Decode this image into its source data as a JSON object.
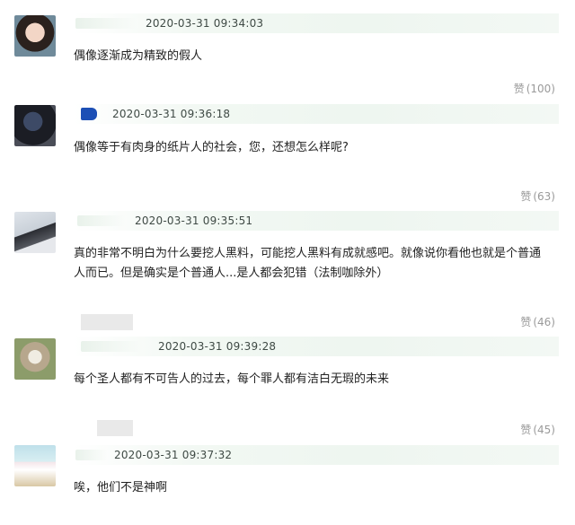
{
  "comments": [
    {
      "timestamp": "2020-03-31 09:34:03",
      "text": "偶像逐渐成为精致的假人",
      "likes_label": "赞",
      "likes_count": "(100)"
    },
    {
      "timestamp": "2020-03-31 09:36:18",
      "text": "偶像等于有肉身的纸片人的社会，您，还想怎么样呢?",
      "likes_label": "赞",
      "likes_count": "(63)"
    },
    {
      "timestamp": "2020-03-31 09:35:51",
      "text_line1": "真的非常不明白为什么要挖人黑料，可能挖人黑料有成就感吧。就像说你看他也就是个普通",
      "text_line2": "人而已。但是确实是个普通人...是人都会犯错（法制咖除外）",
      "likes_label": "赞",
      "likes_count": "(46)"
    },
    {
      "timestamp": "2020-03-31 09:39:28",
      "text": "每个圣人都有不可告人的过去，每个罪人都有洁白无瑕的未来",
      "likes_label": "赞",
      "likes_count": "(45)"
    },
    {
      "timestamp": "2020-03-31 09:37:32",
      "text": "唉，他们不是神啊"
    }
  ]
}
